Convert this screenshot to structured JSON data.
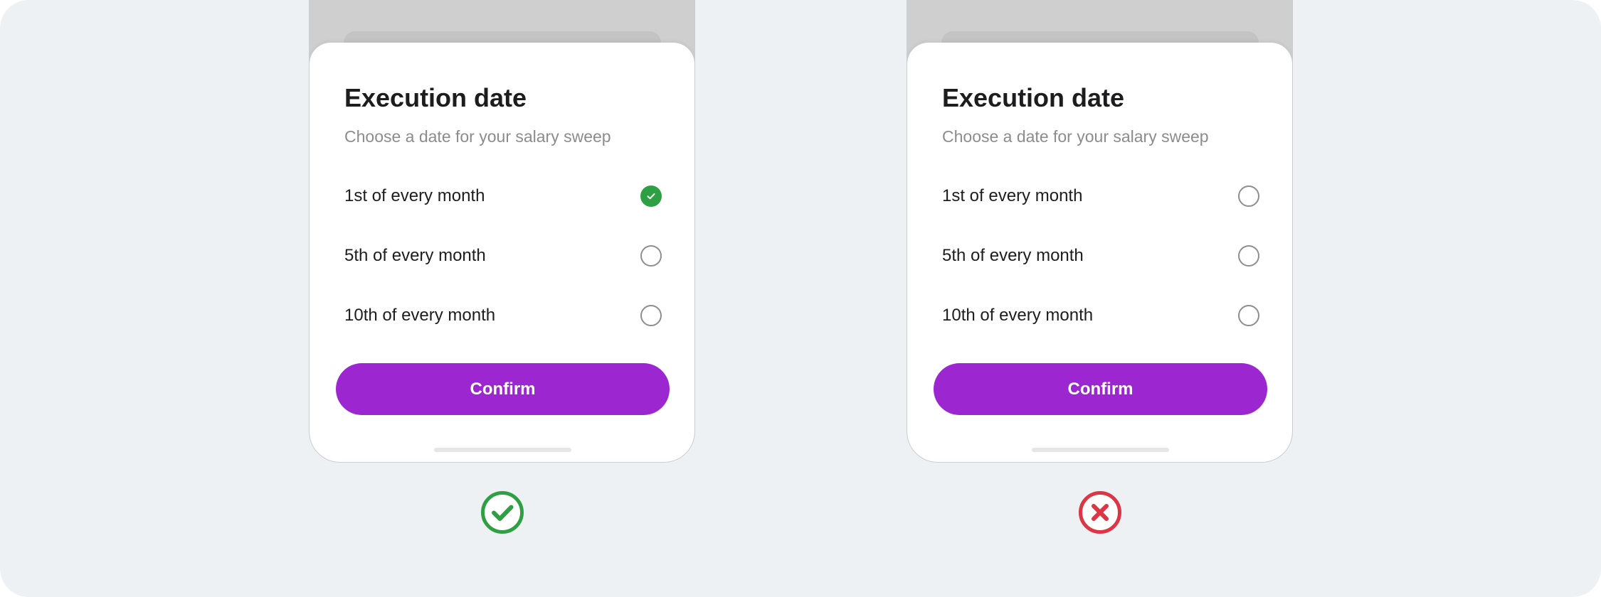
{
  "examples": [
    {
      "verdict": "correct",
      "verdict_icon": "check-circle-icon",
      "verdict_color": "#2ea043",
      "sheet": {
        "title": "Execution date",
        "subtitle": "Choose a date for your salary sweep",
        "options": [
          {
            "label": "1st of every month",
            "selected": true
          },
          {
            "label": "5th of every month",
            "selected": false
          },
          {
            "label": "10th of every month",
            "selected": false
          }
        ],
        "confirm_label": "Confirm"
      }
    },
    {
      "verdict": "incorrect",
      "verdict_icon": "x-circle-icon",
      "verdict_color": "#dc3545",
      "sheet": {
        "title": "Execution date",
        "subtitle": "Choose a date for your salary sweep",
        "options": [
          {
            "label": "1st of every month",
            "selected": false
          },
          {
            "label": "5th of every month",
            "selected": false
          },
          {
            "label": "10th of every month",
            "selected": false
          }
        ],
        "confirm_label": "Confirm"
      }
    }
  ],
  "colors": {
    "accent": "#9c27d0",
    "selected": "#2ea043",
    "error": "#dc3545",
    "background": "#eef1f4"
  }
}
